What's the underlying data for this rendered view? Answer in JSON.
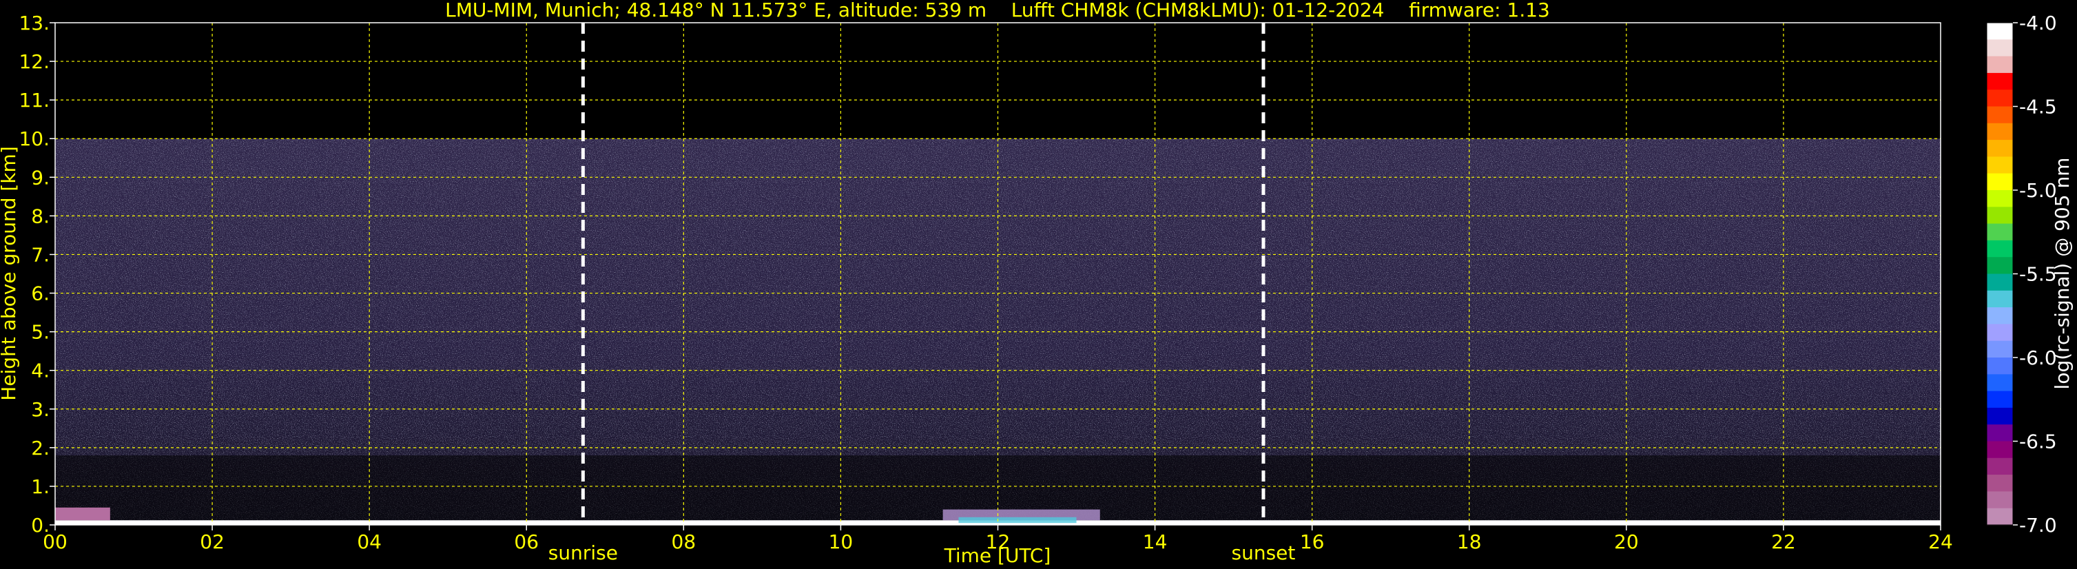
{
  "chart_data": {
    "type": "heatmap",
    "title": "LMU-MIM, Munich; 48.148° N 11.573° E, altitude: 539 m    Lufft CHM8k (CHM8kLMU): 01-12-2024    firmware: 1.13",
    "xlabel": "Time [UTC]",
    "ylabel": "Height above ground [km]",
    "xlim": [
      0,
      24
    ],
    "ylim": [
      0,
      13
    ],
    "x_ticks": [
      "00",
      "02",
      "04",
      "06",
      "08",
      "10",
      "12",
      "14",
      "16",
      "18",
      "20",
      "22",
      "24"
    ],
    "y_ticks": [
      "0.",
      "1.",
      "2.",
      "3.",
      "4.",
      "5.",
      "6.",
      "7.",
      "8.",
      "9.",
      "10.",
      "11.",
      "12.",
      "13."
    ],
    "grid": true,
    "data_top_km": 10.0,
    "markers": [
      {
        "label": "sunrise",
        "time": 6.72
      },
      {
        "label": "sunset",
        "time": 15.38
      }
    ],
    "colorbar": {
      "label": "log(rc-signal) @ 905 nm",
      "range": [
        -7.0,
        -4.0
      ],
      "ticks": [
        "-4.0",
        "-4.5",
        "-5.0",
        "-5.5",
        "-6.0",
        "-6.5",
        "-7.0"
      ],
      "colors": [
        "#ffffff",
        "#f2dada",
        "#eeb4b4",
        "#ff0000",
        "#ff2800",
        "#ff5a00",
        "#ff8c00",
        "#ffb400",
        "#ffd200",
        "#ffff00",
        "#c8ff00",
        "#96e600",
        "#50d250",
        "#00c864",
        "#00aa50",
        "#00aa96",
        "#50c8dc",
        "#8cb4ff",
        "#a0a0ff",
        "#7896ff",
        "#5078ff",
        "#1e64ff",
        "#0032ff",
        "#0000c8",
        "#6e0096",
        "#8c0078",
        "#9b2882",
        "#aa508c",
        "#b46ea0",
        "#c08cb4"
      ]
    }
  }
}
